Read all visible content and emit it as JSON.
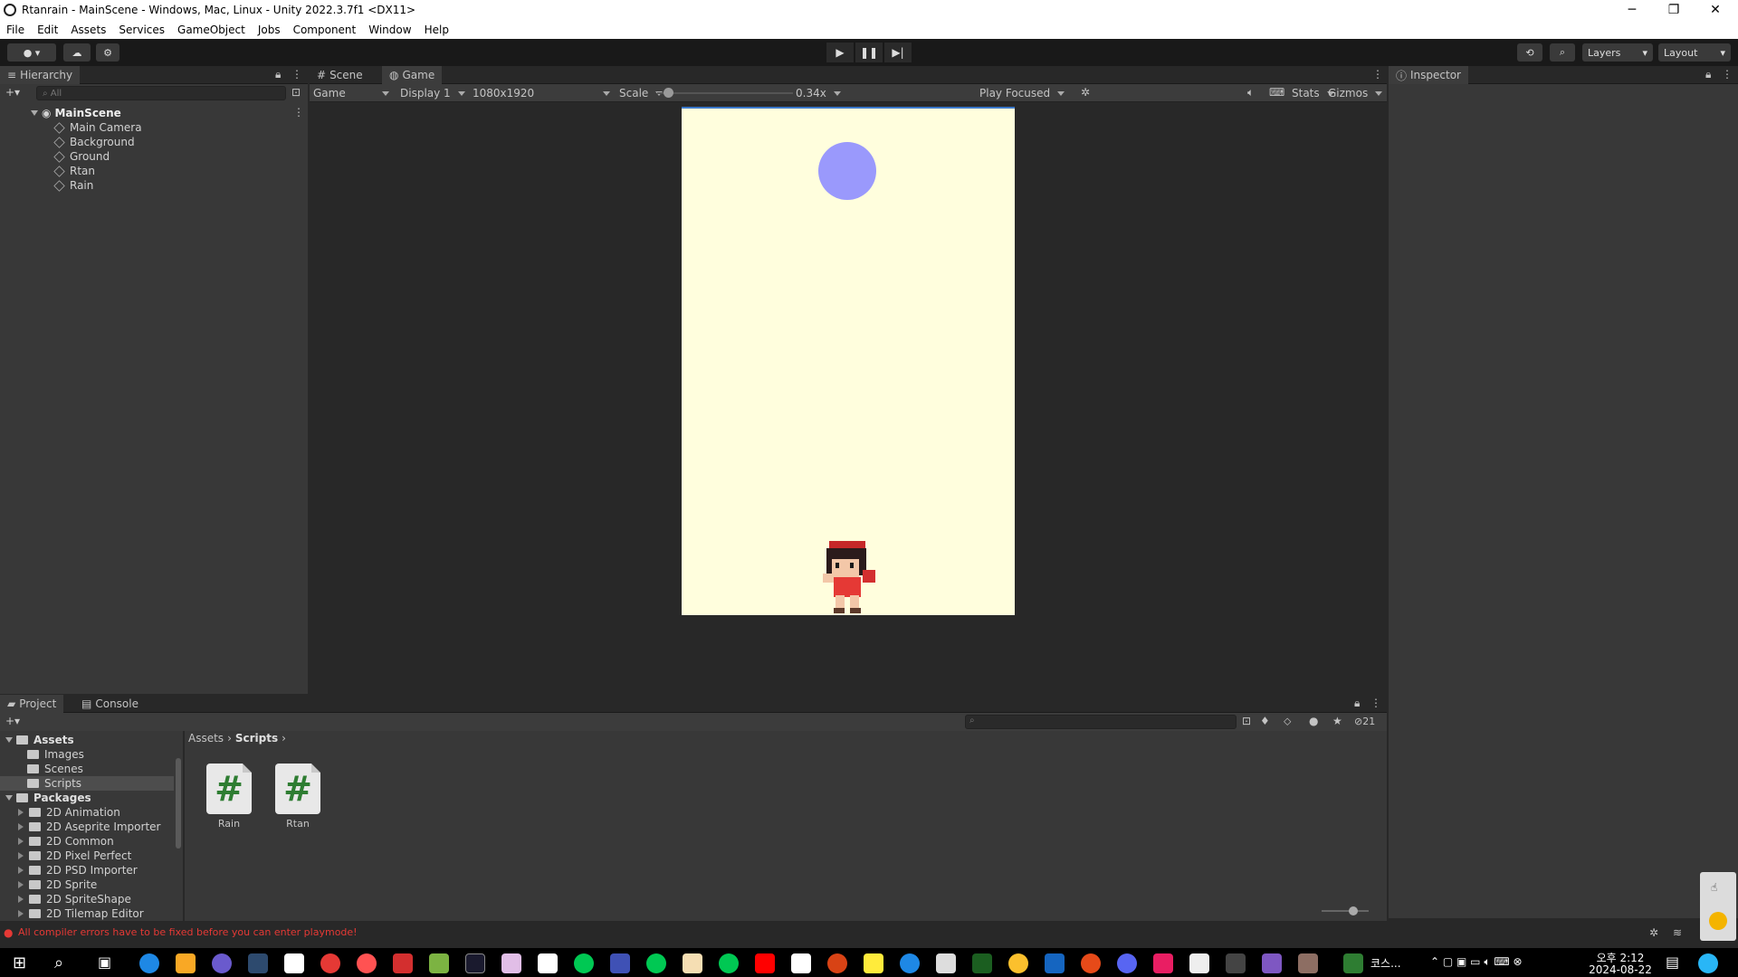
{
  "window": {
    "title": "Rtanrain - MainScene - Windows, Mac, Linux - Unity 2022.3.7f1 <DX11>"
  },
  "menu": [
    "File",
    "Edit",
    "Assets",
    "Services",
    "GameObject",
    "Jobs",
    "Component",
    "Window",
    "Help"
  ],
  "toolbar": {
    "layers_label": "Layers",
    "layout_label": "Layout"
  },
  "hierarchy": {
    "tab": "Hierarchy",
    "search_placeholder": "All",
    "scene": "MainScene",
    "items": [
      "Main Camera",
      "Background",
      "Ground",
      "Rtan",
      "Rain"
    ]
  },
  "game_view": {
    "tabs": [
      "Scene",
      "Game"
    ],
    "mode": "Game",
    "display": "Display 1",
    "resolution": "1080x1920",
    "scale_label": "Scale",
    "scale_value": "0.34x",
    "scale_fraction": 0.05,
    "play_focused": "Play Focused",
    "stats": "Stats",
    "gizmos": "Gizmos",
    "colors": {
      "background": "#fffedd",
      "rain": "#9a99fc"
    }
  },
  "inspector": {
    "tab": "Inspector"
  },
  "project": {
    "tabs": [
      "Project",
      "Console"
    ],
    "tree": [
      {
        "label": "Assets",
        "level": 0,
        "bold": true
      },
      {
        "label": "Images",
        "level": 1
      },
      {
        "label": "Scenes",
        "level": 1
      },
      {
        "label": "Scripts",
        "level": 1,
        "selected": true
      },
      {
        "label": "Packages",
        "level": 0,
        "bold": true
      },
      {
        "label": "2D Animation",
        "level": 1
      },
      {
        "label": "2D Aseprite Importer",
        "level": 1
      },
      {
        "label": "2D Common",
        "level": 1
      },
      {
        "label": "2D Pixel Perfect",
        "level": 1
      },
      {
        "label": "2D PSD Importer",
        "level": 1
      },
      {
        "label": "2D Sprite",
        "level": 1
      },
      {
        "label": "2D SpriteShape",
        "level": 1
      },
      {
        "label": "2D Tilemap Editor",
        "level": 1
      }
    ],
    "breadcrumb": [
      "Assets",
      "Scripts"
    ],
    "files": [
      "Rain",
      "Rtan"
    ],
    "hidden_count": "21"
  },
  "status": {
    "error": "All compiler errors have to be fixed before you can enter playmode!"
  },
  "taskbar": {
    "lang": "코스...",
    "time": "오후 2:12",
    "date": "2024-08-22"
  }
}
